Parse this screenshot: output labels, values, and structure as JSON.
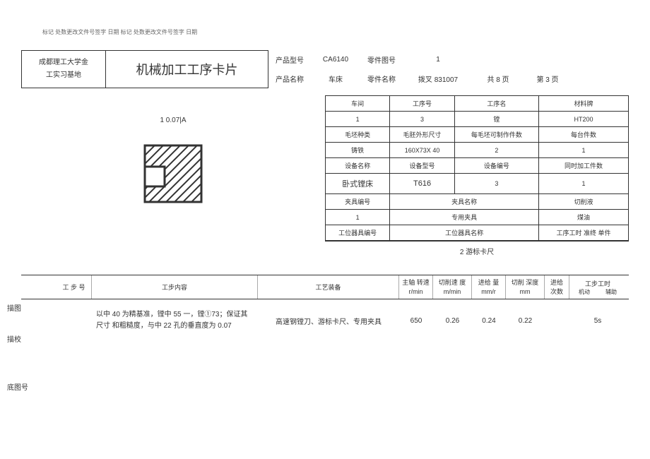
{
  "revision_note": "标记 处数更改文件号签字  日期 标记 处数更改文件号签字 日期",
  "school_line1": "成都理工大学金",
  "school_line2": "工实习基地",
  "title": "机械加工工序卡片",
  "header": {
    "product_model_label": "产品型号",
    "product_model": "CA6140",
    "part_drawing_label": "零件图号",
    "part_drawing": "1",
    "product_name_label": "产品名称",
    "product_name": "车床",
    "part_name_label": "零件名称",
    "part_name": "拨叉 831007",
    "pages_label": "共 8 页",
    "page_no": "第 3 页"
  },
  "dim_text": "1 0.07|A",
  "info": {
    "r1": {
      "c1_label": "车间",
      "c2_label": "工序号",
      "c3_label": "工序名",
      "c4_label": "材料牌"
    },
    "r2": {
      "c1": "1",
      "c2": "3",
      "c3": "镗",
      "c4": "HT200"
    },
    "r3": {
      "c1_label": "毛坯种类",
      "c2_label": "毛胚外形尺寸",
      "c3_label": "每毛坯可制作件数",
      "c4_label": "每台件数"
    },
    "r4": {
      "c1": "铸铁",
      "c2": "160X73X 40",
      "c3": "2",
      "c4": "1"
    },
    "r5": {
      "c1_label": "设备名称",
      "c2_label": "设备型号",
      "c3_label": "设备编号",
      "c4_label": "同时加工件数"
    },
    "r6": {
      "c1": "卧式镗床",
      "c2": "T616",
      "c3": "3",
      "c4": "1"
    },
    "r7": {
      "c1_label": "夹具编号",
      "c2_label": "夹具名称",
      "c3_label": "切削液"
    },
    "r8": {
      "c1": "1",
      "c2": "专用夹具",
      "c3": "煤油"
    },
    "r9": {
      "c1_label": "工位器具编号",
      "c2_label": "工位器具名称",
      "c3_label": "工序工时 准终 单件"
    }
  },
  "vernier": "2 游标卡尺",
  "side_labels": {
    "miaotu": "描图",
    "miaojiao": "描校",
    "ditu": "底图号"
  },
  "steps_header": {
    "stepno": "工  步 号",
    "content": "工步内容",
    "equip": "工艺装备",
    "rpm_l1": "主轴 转速",
    "rpm_l2": "r/min",
    "cutspeed_l1": "切削速  度",
    "cutspeed_l2": "m/min",
    "feed_l1": "进给 量",
    "feed_l2": "mm/r",
    "depth_l1": "切削 深度",
    "depth_l2": "mm",
    "passes_l1": "进给",
    "passes_l2": "次数",
    "time_label": "工步工时",
    "time_sub1": "机动",
    "time_sub2": "辅助"
  },
  "step1": {
    "content": "以中 40 为精基准，镗中 55 一，镗①73；保证其尺寸 和粗糙度，与中 22 孔的垂直度为 0.07",
    "equip": "高速钢镗刀、游标卡尺、专用夹具",
    "rpm": "650",
    "cutspeed": "0.26",
    "feed": "0.24",
    "depth": "0.22",
    "passes": "",
    "time": "5s"
  }
}
